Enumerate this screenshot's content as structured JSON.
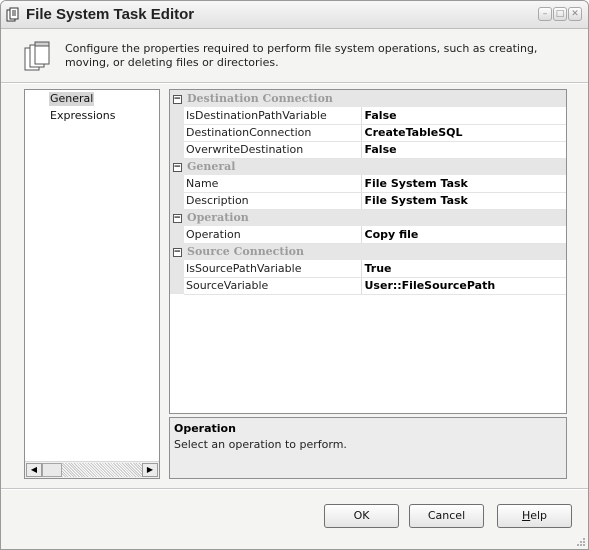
{
  "window": {
    "title": "File System Task Editor",
    "controls": [
      "minimize",
      "maximize",
      "close"
    ]
  },
  "header": {
    "description": "Configure the properties required to perform file system operations, such as creating, moving, or deleting files or directories."
  },
  "nav": {
    "items": [
      {
        "label": "General",
        "selected": true
      },
      {
        "label": "Expressions",
        "selected": false
      }
    ]
  },
  "grid": {
    "categories": [
      {
        "name": "Destination Connection",
        "rows": [
          {
            "name": "IsDestinationPathVariable",
            "value": "False"
          },
          {
            "name": "DestinationConnection",
            "value": "CreateTableSQL"
          },
          {
            "name": "OverwriteDestination",
            "value": "False"
          }
        ]
      },
      {
        "name": "General",
        "rows": [
          {
            "name": "Name",
            "value": "File System Task"
          },
          {
            "name": "Description",
            "value": "File System Task"
          }
        ]
      },
      {
        "name": "Operation",
        "rows": [
          {
            "name": "Operation",
            "value": "Copy file"
          }
        ]
      },
      {
        "name": "Source Connection",
        "rows": [
          {
            "name": "IsSourcePathVariable",
            "value": "True"
          },
          {
            "name": "SourceVariable",
            "value": "User::FileSourcePath"
          }
        ]
      }
    ]
  },
  "description_panel": {
    "title": "Operation",
    "text": "Select an operation to perform."
  },
  "buttons": {
    "ok": "OK",
    "cancel": "Cancel",
    "help": "Help"
  }
}
